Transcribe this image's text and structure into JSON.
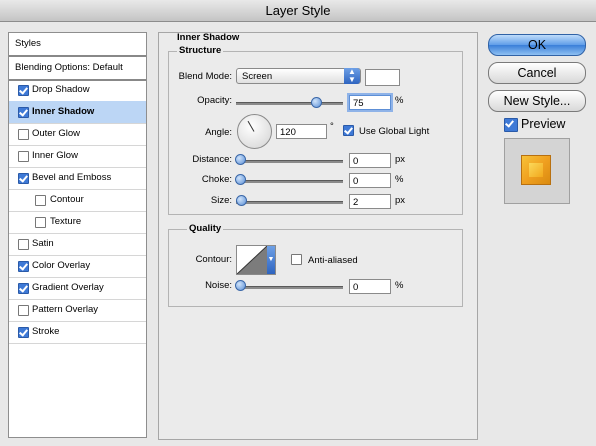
{
  "window": {
    "title": "Layer Style"
  },
  "sidebar": {
    "header": "Styles",
    "items": [
      {
        "label": "Blending Options: Default",
        "checkbox": false,
        "checked": false,
        "indent": false,
        "selected": false,
        "header": true
      },
      {
        "label": "Drop Shadow",
        "checkbox": true,
        "checked": true,
        "indent": false,
        "selected": false
      },
      {
        "label": "Inner Shadow",
        "checkbox": true,
        "checked": true,
        "indent": false,
        "selected": true
      },
      {
        "label": "Outer Glow",
        "checkbox": true,
        "checked": false,
        "indent": false,
        "selected": false
      },
      {
        "label": "Inner Glow",
        "checkbox": true,
        "checked": false,
        "indent": false,
        "selected": false
      },
      {
        "label": "Bevel and Emboss",
        "checkbox": true,
        "checked": true,
        "indent": false,
        "selected": false
      },
      {
        "label": "Contour",
        "checkbox": true,
        "checked": false,
        "indent": true,
        "selected": false
      },
      {
        "label": "Texture",
        "checkbox": true,
        "checked": false,
        "indent": true,
        "selected": false
      },
      {
        "label": "Satin",
        "checkbox": true,
        "checked": false,
        "indent": false,
        "selected": false
      },
      {
        "label": "Color Overlay",
        "checkbox": true,
        "checked": true,
        "indent": false,
        "selected": false
      },
      {
        "label": "Gradient Overlay",
        "checkbox": true,
        "checked": true,
        "indent": false,
        "selected": false
      },
      {
        "label": "Pattern Overlay",
        "checkbox": true,
        "checked": false,
        "indent": false,
        "selected": false
      },
      {
        "label": "Stroke",
        "checkbox": true,
        "checked": true,
        "indent": false,
        "selected": false
      }
    ]
  },
  "panel": {
    "title": "Inner Shadow",
    "structure": {
      "legend": "Structure",
      "blend_mode_label": "Blend Mode:",
      "blend_mode_value": "Screen",
      "swatch_color": "#ffffff",
      "opacity_label": "Opacity:",
      "opacity_value": "75",
      "opacity_unit": "%",
      "opacity_fraction": 0.75,
      "angle_label": "Angle:",
      "angle_value": "120",
      "angle_unit": "°",
      "use_global_light_label": "Use Global Light",
      "use_global_light_checked": true,
      "distance_label": "Distance:",
      "distance_value": "0",
      "distance_unit": "px",
      "choke_label": "Choke:",
      "choke_value": "0",
      "choke_unit": "%",
      "size_label": "Size:",
      "size_value": "2",
      "size_unit": "px"
    },
    "quality": {
      "legend": "Quality",
      "contour_label": "Contour:",
      "anti_aliased_label": "Anti-aliased",
      "anti_aliased_checked": false,
      "noise_label": "Noise:",
      "noise_value": "0",
      "noise_unit": "%"
    }
  },
  "buttons": {
    "ok": "OK",
    "cancel": "Cancel",
    "new_style": "New Style...",
    "preview_label": "Preview",
    "preview_checked": true
  },
  "colors": {
    "accent": "#3e79d6",
    "preview_orange": "#f0a020"
  }
}
